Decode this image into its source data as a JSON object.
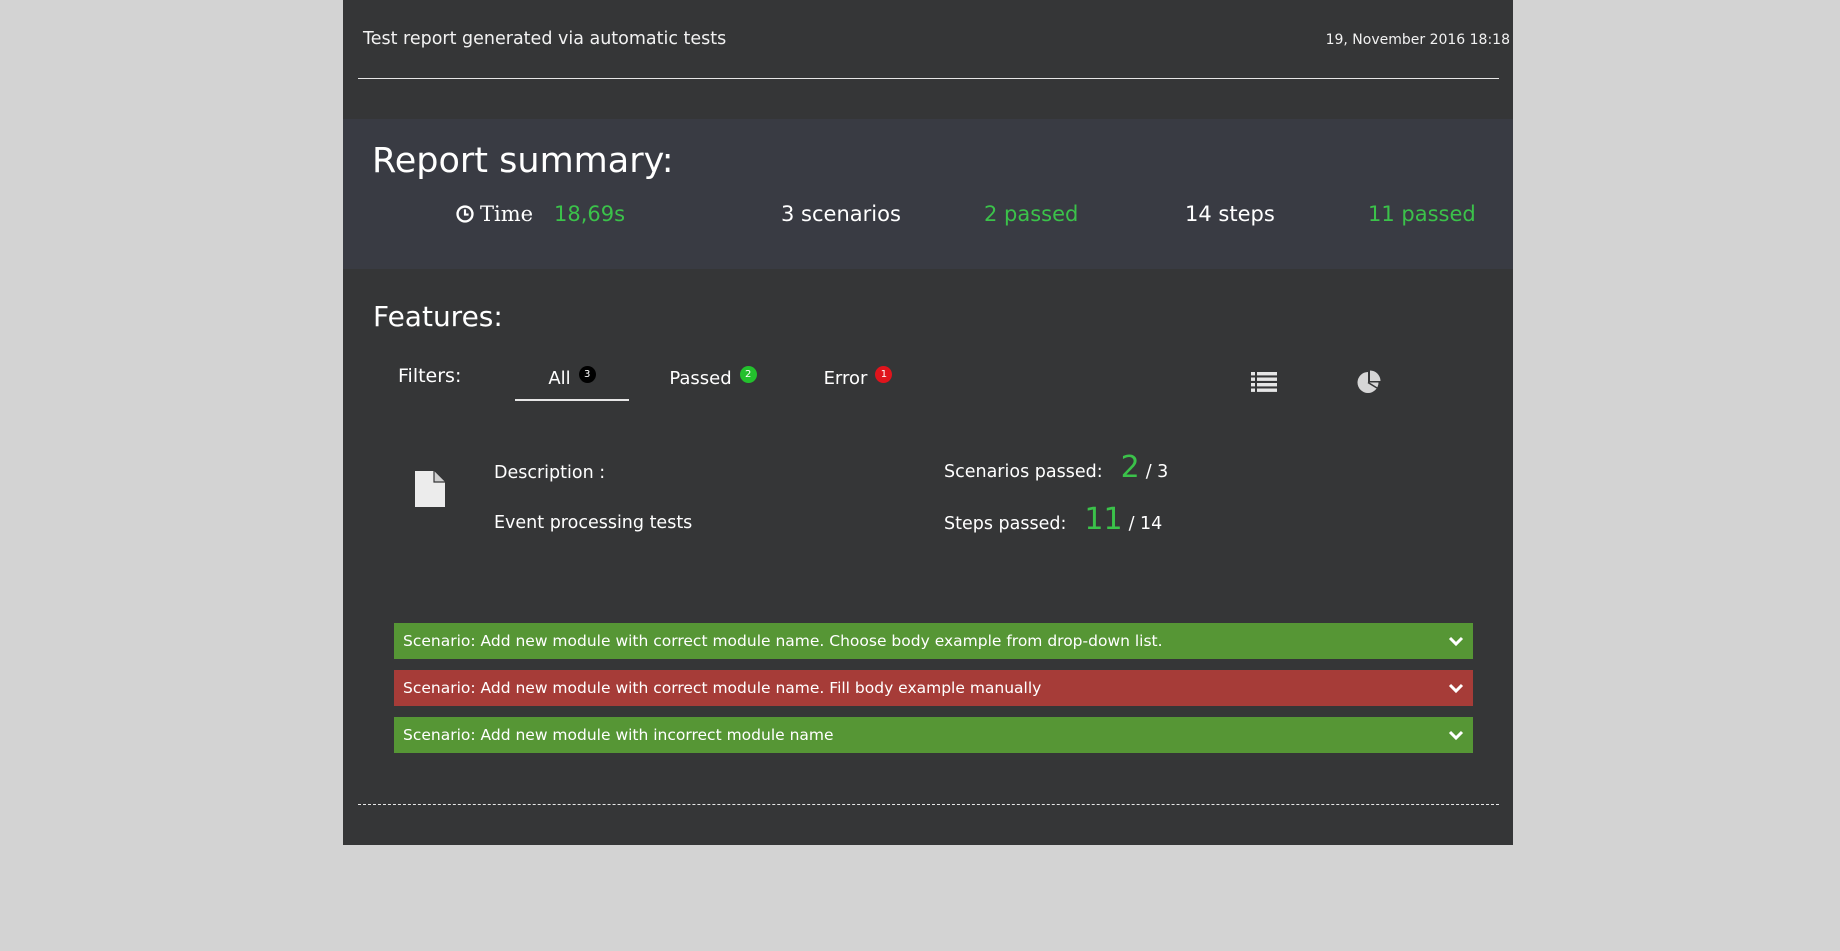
{
  "header": {
    "title": "Test report generated via automatic tests",
    "date": "19, November 2016 18:18"
  },
  "summary": {
    "title": "Report summary:",
    "time_label": "Time",
    "time_value": "18,69s",
    "scenarios_count": "3 scenarios",
    "scenarios_passed": "2 passed",
    "steps_count": "14 steps",
    "steps_passed": "11 passed"
  },
  "features": {
    "title": "Features:",
    "filters_label": "Filters:",
    "filters": [
      {
        "label": "All",
        "count": "3",
        "selected": true
      },
      {
        "label": "Passed",
        "count": "2",
        "selected": false
      },
      {
        "label": "Error",
        "count": "1",
        "selected": false
      }
    ],
    "view_icons": [
      "list-icon",
      "pie-chart-icon"
    ]
  },
  "feature": {
    "icon": "document-icon",
    "description_label": "Description :",
    "description_value": "Event processing tests",
    "scenarios_label": "Scenarios passed:",
    "scenarios_passed": "2",
    "scenarios_total": "/ 3",
    "steps_label": "Steps passed:",
    "steps_passed": "11",
    "steps_total": "/ 14"
  },
  "scenarios": [
    {
      "title": "Scenario: Add new module with correct module name. Choose body example from drop-down list.",
      "status": "passed"
    },
    {
      "title": "Scenario: Add new module with correct module name. Fill body example manually",
      "status": "failed"
    },
    {
      "title": "Scenario: Add new module with incorrect module name",
      "status": "passed"
    }
  ],
  "colors": {
    "passed_text": "#3bc24a",
    "scenario_passed_bg": "#569635",
    "scenario_failed_bg": "#a63c38",
    "panel_bg": "#353637",
    "summary_bg": "#393b43",
    "page_bg": "#d3d3d3"
  }
}
